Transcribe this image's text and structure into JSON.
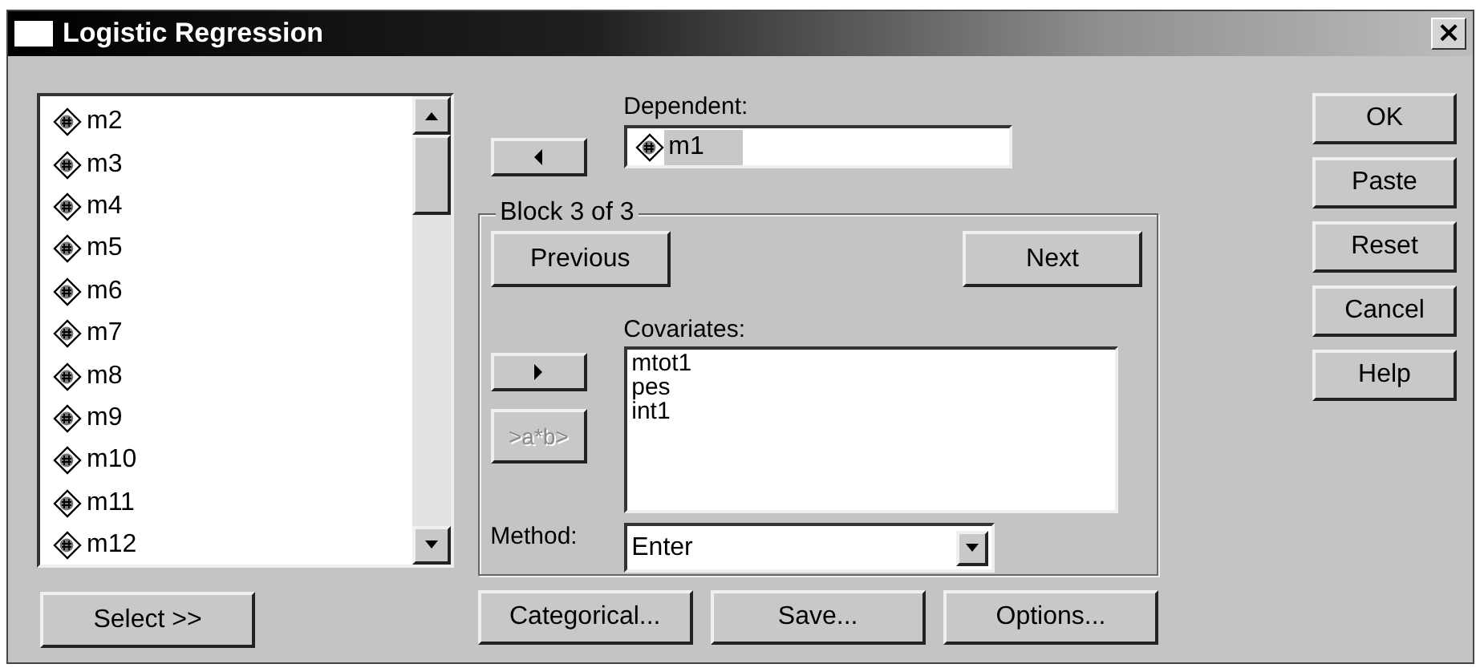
{
  "window": {
    "title": "Logistic Regression",
    "close": "×"
  },
  "variables": {
    "items": [
      {
        "name": "m2"
      },
      {
        "name": "m3"
      },
      {
        "name": "m4"
      },
      {
        "name": "m5"
      },
      {
        "name": "m6"
      },
      {
        "name": "m7"
      },
      {
        "name": "m8"
      },
      {
        "name": "m9"
      },
      {
        "name": "m10"
      },
      {
        "name": "m11"
      },
      {
        "name": "m12"
      }
    ]
  },
  "select_button": "Select >>",
  "dependent": {
    "label": "Dependent:",
    "value": "m1"
  },
  "block": {
    "title": "Block 3 of 3",
    "previous": "Previous",
    "next": "Next",
    "covariates_label": "Covariates:",
    "covariates": [
      "mtot1",
      "pes",
      "int1"
    ],
    "interaction_button": {
      "label": ">a*b>",
      "disabled": true
    },
    "method_label": "Method:",
    "method": "Enter"
  },
  "bottom_buttons": [
    "Categorical...",
    "Save...",
    "Options..."
  ],
  "side_buttons": [
    "OK",
    "Paste",
    "Reset",
    "Cancel",
    "Help"
  ]
}
